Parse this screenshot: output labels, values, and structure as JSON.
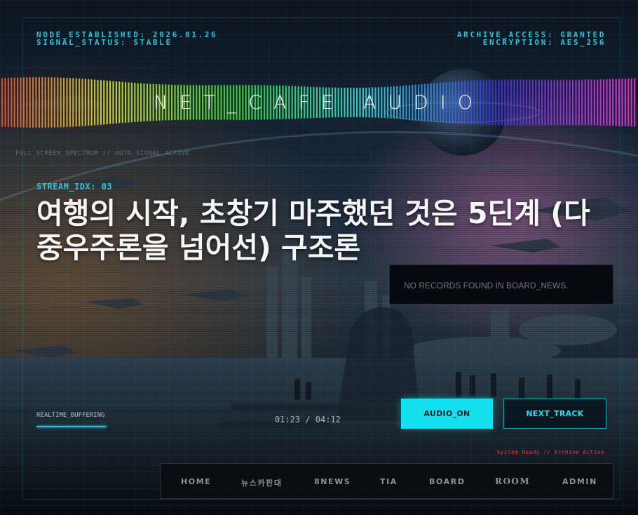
{
  "header": {
    "node": "NODE_ESTABLISHED: 2026.01.26",
    "signal": "SIGNAL_STATUS: STABLE",
    "archive": "ARCHIVE_ACCESS: GRANTED",
    "encryption": "ENCRYPTION: AES_256"
  },
  "brand": "NET_CAFE AUDIO",
  "spectrum_caption": "FULL_SCREEN_SPECTRUM // AUTO_SIGNAL_ACTIVE",
  "stream": {
    "index": "STREAM_IDX: 03",
    "title": "여행의 시작, 초창기 마주했던 것은 5딘계 (다중우주론을 넘어선) 구조론"
  },
  "news": {
    "empty_message": "NO RECORDS FOUND IN BOARD_NEWS."
  },
  "player": {
    "buffer_label": "REALTIME_BUFFERING",
    "time": "01:23 / 04:12",
    "audio_button": "AUDIO_ON",
    "next_button": "NEXT_TRACK",
    "status": "System Ready // Archive Active"
  },
  "nav": {
    "items": [
      "HOME",
      "뉴스카판대",
      "8NEWS",
      "TIA",
      "BOARD",
      "ROOM",
      "ADMIN"
    ]
  },
  "colors": {
    "accent": "#26c6d8",
    "button_fill": "#14e0f0",
    "status_red": "#e0373f",
    "title": "#f6f6f6"
  }
}
